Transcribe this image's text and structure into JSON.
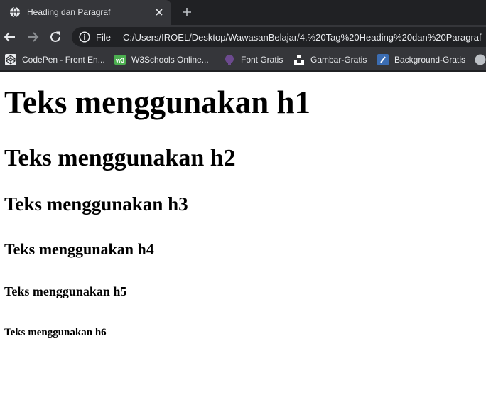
{
  "tab": {
    "title": "Heading dan Paragraf",
    "favicon": "globe-icon"
  },
  "toolbar": {
    "scheme_label": "File",
    "url": "C:/Users/IROEL/Desktop/WawasanBelajar/4.%20Tag%20Heading%20dan%20Paragraf"
  },
  "bookmarks": [
    {
      "label": "CodePen - Front En...",
      "icon": "codepen-icon"
    },
    {
      "label": "W3Schools Online...",
      "icon": "w3schools-icon"
    },
    {
      "label": "Font Gratis",
      "icon": "font-gratis-icon"
    },
    {
      "label": "Gambar-Gratis",
      "icon": "gambar-gratis-icon"
    },
    {
      "label": "Background-Gratis",
      "icon": "background-gratis-icon"
    }
  ],
  "content": {
    "h1": "Teks menggunakan h1",
    "h2": "Teks menggunakan h2",
    "h3": "Teks menggunakan h3",
    "h4": "Teks menggunakan h4",
    "h5": "Teks menggunakan h5",
    "h6": "Teks menggunakan h6"
  },
  "colors": {
    "tabstrip": "#202124",
    "active_tab": "#35363a",
    "omnibox": "#202124",
    "text_light": "#e8eaed",
    "page_bg": "#ffffff"
  }
}
